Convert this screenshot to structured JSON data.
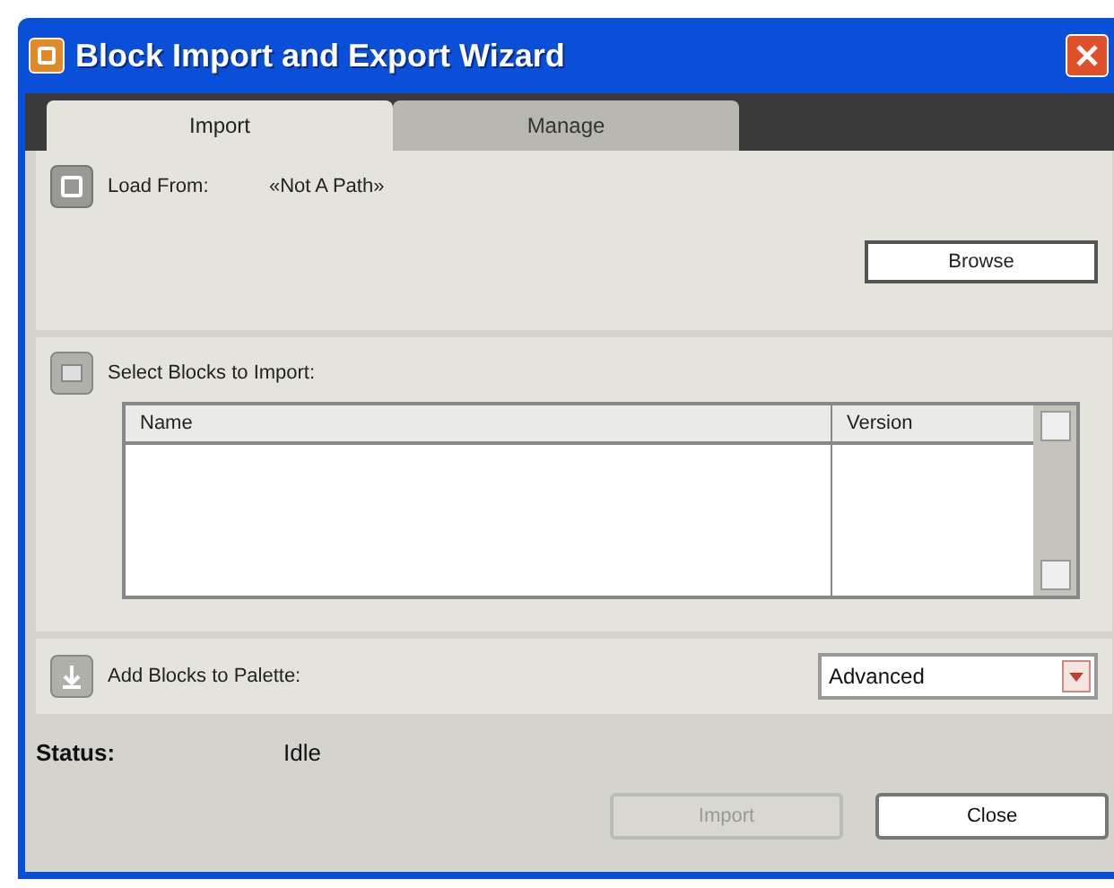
{
  "window": {
    "title": "Block Import and Export Wizard"
  },
  "tabs": [
    {
      "label": "Import",
      "selected": true
    },
    {
      "label": "Manage",
      "selected": false
    }
  ],
  "load_from": {
    "label": "Load From:",
    "value": "«Not A Path»",
    "browse_button": "Browse"
  },
  "select_blocks": {
    "label": "Select Blocks to Import:",
    "columns": [
      "Name",
      "Version"
    ]
  },
  "add_to_palette": {
    "label": "Add Blocks to Palette:",
    "value": "Advanced"
  },
  "status": {
    "label": "Status:",
    "value": "Idle"
  },
  "buttons": [
    {
      "label": "Import",
      "disabled": true
    },
    {
      "label": "Close",
      "disabled": false
    }
  ]
}
